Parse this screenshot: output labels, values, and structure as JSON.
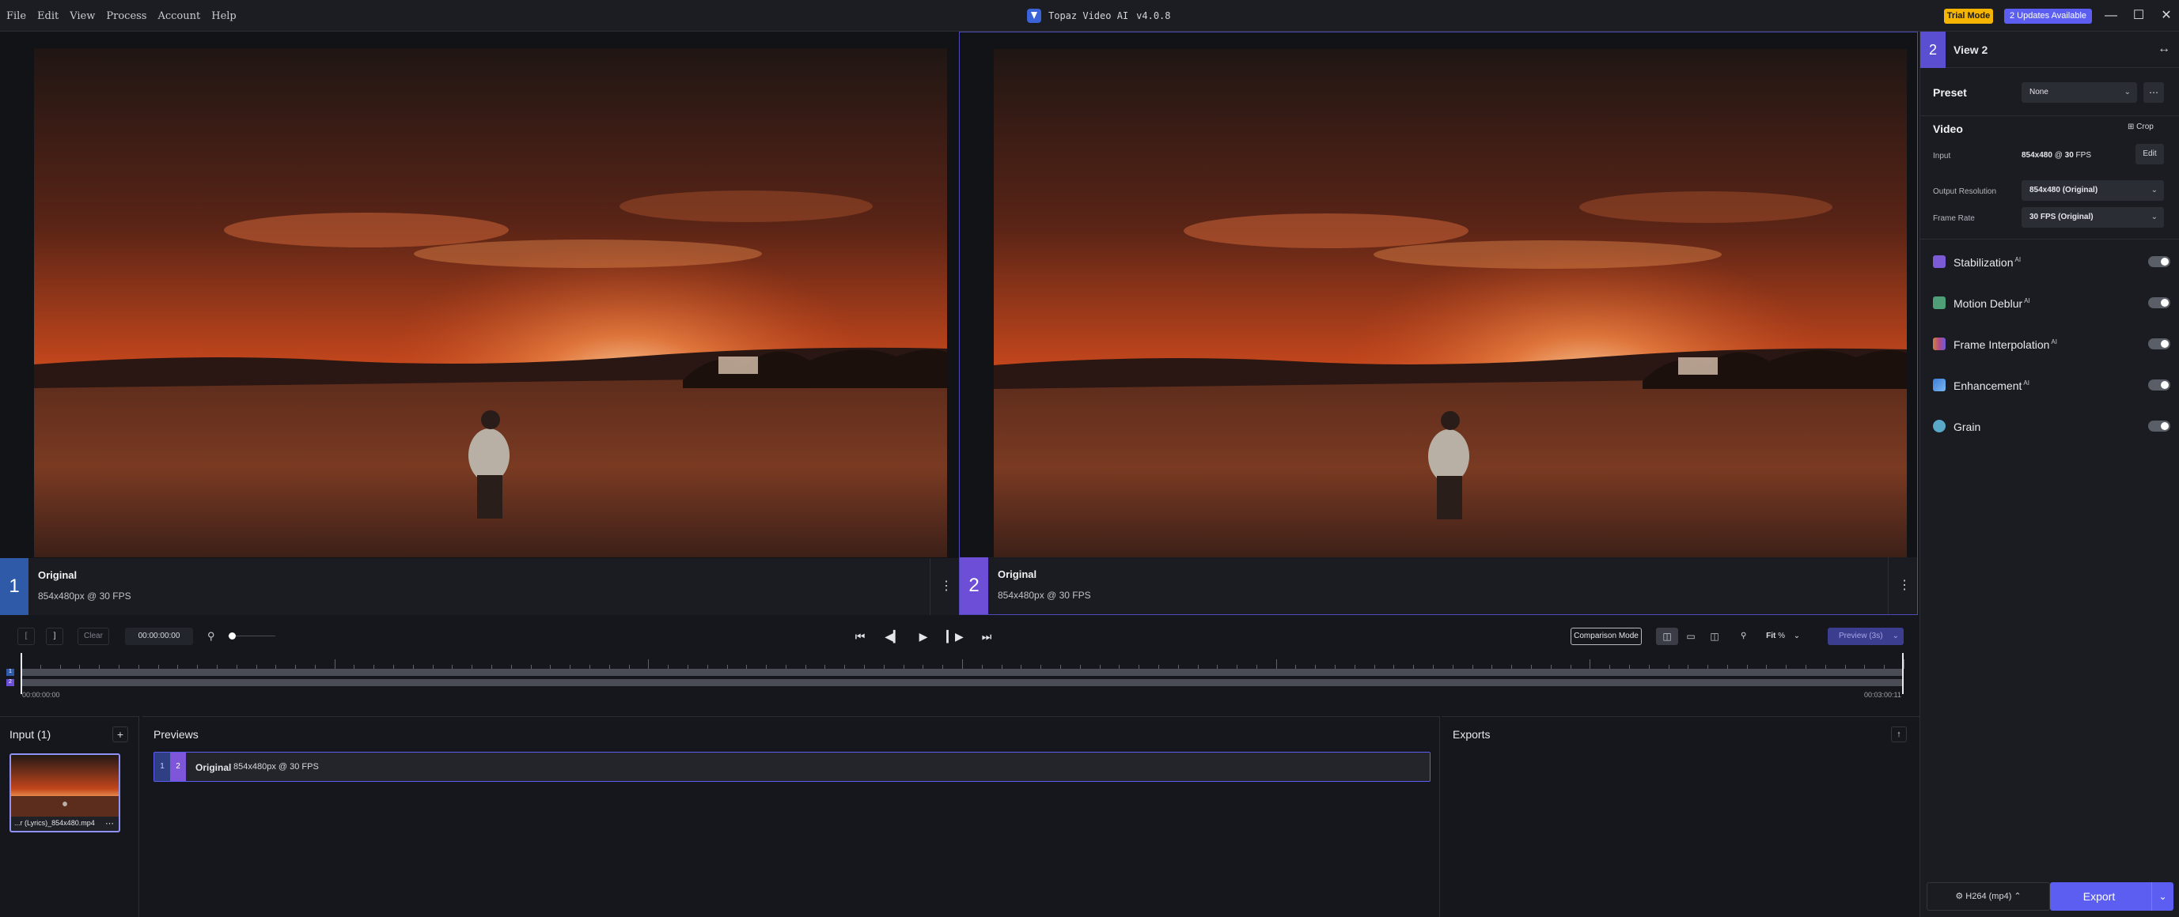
{
  "titlebar": {
    "menu": [
      "File",
      "Edit",
      "View",
      "Process",
      "Account",
      "Help"
    ],
    "app_name": "Topaz Video AI",
    "version": "v4.0.8",
    "trial_label": "Trial Mode",
    "updates_label": "2 Updates Available",
    "window_controls": [
      "minimize-icon",
      "maximize-icon",
      "close-icon"
    ]
  },
  "viewers": [
    {
      "number": "1",
      "title": "Original",
      "subtitle": "854x480px @ 30 FPS",
      "accent": "#2f5aa8"
    },
    {
      "number": "2",
      "title": "Original",
      "subtitle": "854x480px @ 30 FPS",
      "accent": "#6c4fd6"
    }
  ],
  "right_panel": {
    "view_number": "2",
    "view_name": "View 2",
    "preset_label": "Preset",
    "preset_value": "None",
    "video_label": "Video",
    "crop_label": "Crop",
    "input_label": "Input",
    "input_value_bold": "854x480",
    "input_value_at": " @ ",
    "input_value_fps": "30",
    "input_value_unit": " FPS",
    "edit_label": "Edit",
    "output_resolution_label": "Output Resolution",
    "output_resolution_value": "854x480 (Original)",
    "frame_rate_label": "Frame Rate",
    "frame_rate_value": "30 FPS (Original)",
    "features": [
      {
        "name": "Stabilization",
        "ai": "AI",
        "color": "#7b5cd6"
      },
      {
        "name": "Motion Deblur",
        "ai": "AI",
        "color": "#4e9e78"
      },
      {
        "name": "Frame Interpolation",
        "ai": "AI",
        "color": "#d0833c"
      },
      {
        "name": "Enhancement",
        "ai": "AI",
        "color": "#3d7fd8"
      },
      {
        "name": "Grain",
        "ai": "",
        "color": "#5aa8c8"
      }
    ],
    "encoder_label": "H264 (mp4)",
    "export_label": "Export"
  },
  "transport": {
    "mark_in": "[",
    "mark_out": "]",
    "clear_label": "Clear",
    "timecode": "00:00:00:00",
    "comparison_label": "Comparison Mode",
    "zoom_value": "Fit",
    "zoom_unit": "%",
    "preview_label": "Preview (3s)"
  },
  "timeline": {
    "start": "00:00:00:00",
    "end": "00:03:00:11",
    "playhead": 0
  },
  "input_panel": {
    "title": "Input (1)",
    "file_name": "...r (Lyrics)_854x480.mp4"
  },
  "previews_panel": {
    "title": "Previews",
    "row": {
      "n1": "1",
      "n2": "2",
      "title": "Original",
      "info": "854x480px @ 30 FPS"
    }
  },
  "exports_panel": {
    "title": "Exports"
  },
  "colors": {
    "accent": "#5b5ef0",
    "trial": "#f4b400",
    "bg": "#15171c"
  }
}
